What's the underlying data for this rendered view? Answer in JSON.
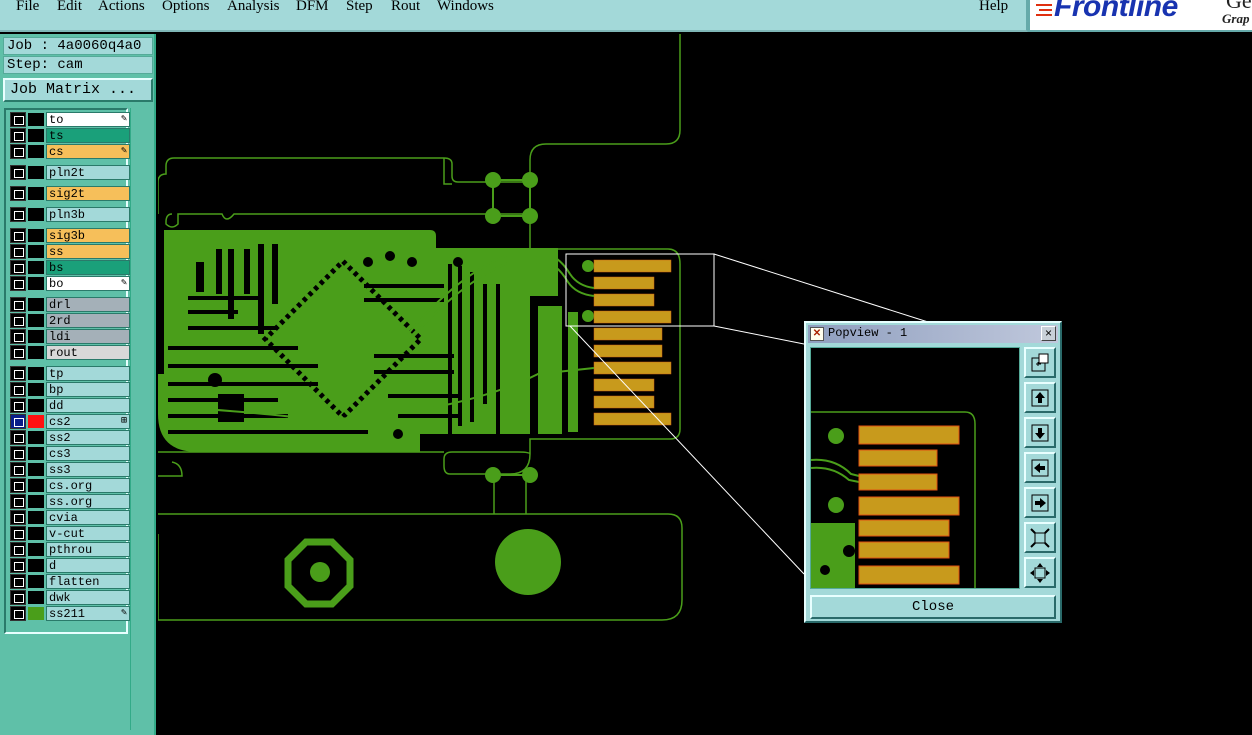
{
  "menubar": {
    "items": [
      "File",
      "Edit",
      "Actions",
      "Options",
      "Analysis",
      "DFM",
      "Step",
      "Rout",
      "Windows"
    ],
    "help": "Help"
  },
  "logo": {
    "text": "Frontline",
    "text2": "Gen",
    "sub": "Grap"
  },
  "job": {
    "job_line": "Job : 4a0060q4a0",
    "step_line": "Step: cam",
    "matrix_button": "Job Matrix ..."
  },
  "layers": [
    {
      "label": "to",
      "bg": "#ffffff",
      "mark": "✎"
    },
    {
      "label": "ts",
      "bg": "#1aa07a"
    },
    {
      "label": "cs",
      "bg": "#f6bf5a",
      "mark": "✎"
    },
    {
      "label": "pln2t",
      "bg": "#a3d9d9"
    },
    {
      "label": "sig2t",
      "bg": "#f6bf5a"
    },
    {
      "label": "pln3b",
      "bg": "#a3d9d9"
    },
    {
      "label": "sig3b",
      "bg": "#f6bf5a"
    },
    {
      "label": "ss",
      "bg": "#f6bf5a"
    },
    {
      "label": "bs",
      "bg": "#1aa07a"
    },
    {
      "label": "bo",
      "bg": "#ffffff",
      "mark": "✎"
    },
    {
      "label": "drl",
      "bg": "#a4b0b8"
    },
    {
      "label": "2rd",
      "bg": "#a4b0b8"
    },
    {
      "label": "ldi",
      "bg": "#a4b0b8"
    },
    {
      "label": "rout",
      "bg": "#d8d8d8"
    },
    {
      "label": "tp",
      "bg": "#a3d9d9"
    },
    {
      "label": "bp",
      "bg": "#a3d9d9"
    },
    {
      "label": "dd",
      "bg": "#a3d9d9"
    },
    {
      "label": "cs2",
      "bg": "#a3d9d9",
      "mark": "⊞",
      "color": "#ff1010",
      "active": true
    },
    {
      "label": "ss2",
      "bg": "#a3d9d9"
    },
    {
      "label": "cs3",
      "bg": "#a3d9d9"
    },
    {
      "label": "ss3",
      "bg": "#a3d9d9"
    },
    {
      "label": "cs.org",
      "bg": "#a3d9d9"
    },
    {
      "label": "ss.org",
      "bg": "#a3d9d9"
    },
    {
      "label": "cvia",
      "bg": "#a3d9d9"
    },
    {
      "label": "v-cut",
      "bg": "#a3d9d9"
    },
    {
      "label": "pthrou",
      "bg": "#a3d9d9"
    },
    {
      "label": "d",
      "bg": "#a3d9d9"
    },
    {
      "label": "flatten",
      "bg": "#a3d9d9"
    },
    {
      "label": "dwk",
      "bg": "#a3d9d9"
    },
    {
      "label": "ss211",
      "bg": "#a3d9d9",
      "mark": "✎",
      "color": "#4a9e1a"
    }
  ],
  "popview": {
    "title": "Popview - 1",
    "close_label": "Close",
    "tools": [
      "zoom-fit-icon",
      "pan-up-icon",
      "pan-down-icon",
      "pan-left-icon",
      "pan-right-icon",
      "zoom-out-icon",
      "zoom-in-icon"
    ]
  },
  "colors": {
    "copper": "#4a9e1a",
    "pad": "#d4a020",
    "pad_edge": "#e05010",
    "outline": "#4a9e1a",
    "panel": "#a3d9d9"
  }
}
